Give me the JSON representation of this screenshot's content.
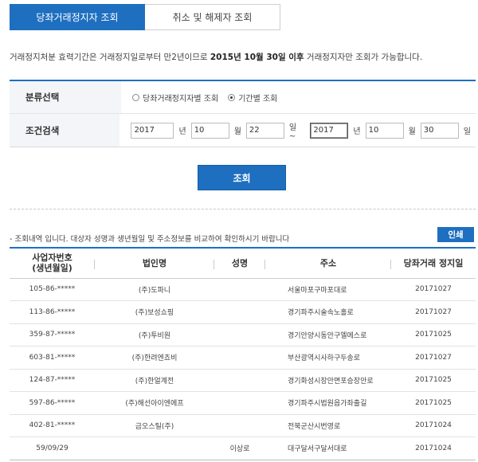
{
  "tabs": [
    {
      "label": "당좌거래정지자 조회",
      "active": true
    },
    {
      "label": "취소 및 해제자 조회",
      "active": false
    }
  ],
  "notice": {
    "before": "거래정지처분 효력기간은 거래정지일로부터 만2년이므로 ",
    "bold": "2015년 10월 30일 이후",
    "after": " 거래정지자만 조회가 가능합니다."
  },
  "form": {
    "category_label": "분류선택",
    "radio_by_person": "당좌거래정지자별 조회",
    "radio_by_period": "기간별 조회",
    "selected": "기간별 조회",
    "condition_label": "조건검색",
    "from_year": "2017",
    "from_month": "10",
    "from_day": "22",
    "to_year": "2017",
    "to_month": "10",
    "to_day": "30",
    "unit_year": "년",
    "unit_month": "월",
    "unit_day": "일",
    "range_sep": "일 ~"
  },
  "search_button": "조회",
  "result_note": "- 조회내역 입니다. 대상자 성명과 생년월일 및 주소정보를 비교하여 확인하시기 바랍니다",
  "print_button": "인쇄",
  "table": {
    "headers": [
      "사업자번호\n(생년월일)",
      "법인명",
      "성명",
      "주소",
      "당좌거래 정지일"
    ],
    "header_line1": "사업자번호",
    "header_line2": "(생년월일)",
    "rows": [
      [
        "105-86-*****",
        "(주)도파니",
        "",
        "서울마포구마포대로",
        "20171027"
      ],
      [
        "113-86-*****",
        "(주)보성쇼핑",
        "",
        "경기파주시술속노홀로",
        "20171027"
      ],
      [
        "359-87-*****",
        "(주)투비원",
        "",
        "경기안양시동안구엘에스로",
        "20171025"
      ],
      [
        "603-81-*****",
        "(주)한려엔쵸비",
        "",
        "부산광역시사하구두송로",
        "20171027"
      ],
      [
        "124-87-*****",
        "(주)한얼계전",
        "",
        "경기화성시장안면포승장안로",
        "20171025"
      ],
      [
        "597-86-*****",
        "(주)해선아이엔에프",
        "",
        "경기파주시법원읍가좌출길",
        "20171025"
      ],
      [
        "402-81-*****",
        "금오스틸(주)",
        "",
        "전북군산시번영로",
        "20171024"
      ],
      [
        "59/09/29",
        "",
        "이상로",
        "대구달서구달서대로",
        "20171024"
      ]
    ]
  },
  "colors": {
    "accent": "#1e6fc0"
  }
}
